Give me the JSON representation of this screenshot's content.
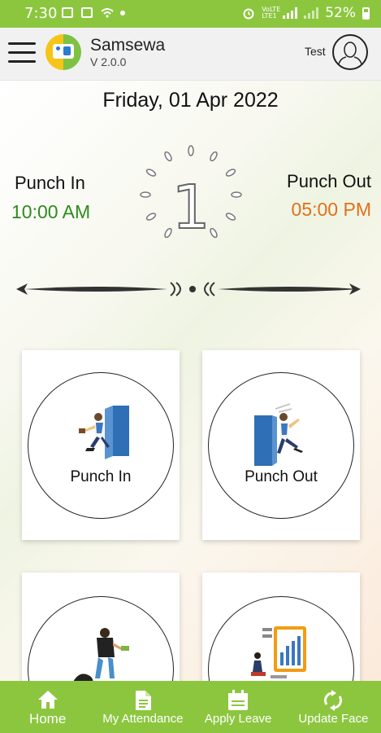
{
  "status_bar": {
    "time": "7:30",
    "network_label": "VoLTE LTE1",
    "battery": "52%"
  },
  "app_bar": {
    "title": "Samsewa",
    "version": "V 2.0.0",
    "user_name": "Test"
  },
  "main": {
    "date": "Friday, 01 Apr 2022",
    "dial_digit": "1",
    "punch_in": {
      "label": "Punch In",
      "time": "10:00 AM"
    },
    "punch_out": {
      "label": "Punch Out",
      "time": "05:00 PM"
    }
  },
  "cards": [
    {
      "label": "Punch In"
    },
    {
      "label": "Punch Out"
    },
    {
      "label": ""
    },
    {
      "label": ""
    }
  ],
  "bottom_nav": [
    {
      "label": "Home",
      "icon": "home-icon"
    },
    {
      "label": "My Attendance",
      "icon": "document-icon"
    },
    {
      "label": "Apply Leave",
      "icon": "calendar-icon"
    },
    {
      "label": "Update Face",
      "icon": "refresh-icon"
    }
  ],
  "colors": {
    "brand_green": "#8cc63f",
    "punch_in_time": "#2e8b1f",
    "punch_out_time": "#e0701a"
  }
}
